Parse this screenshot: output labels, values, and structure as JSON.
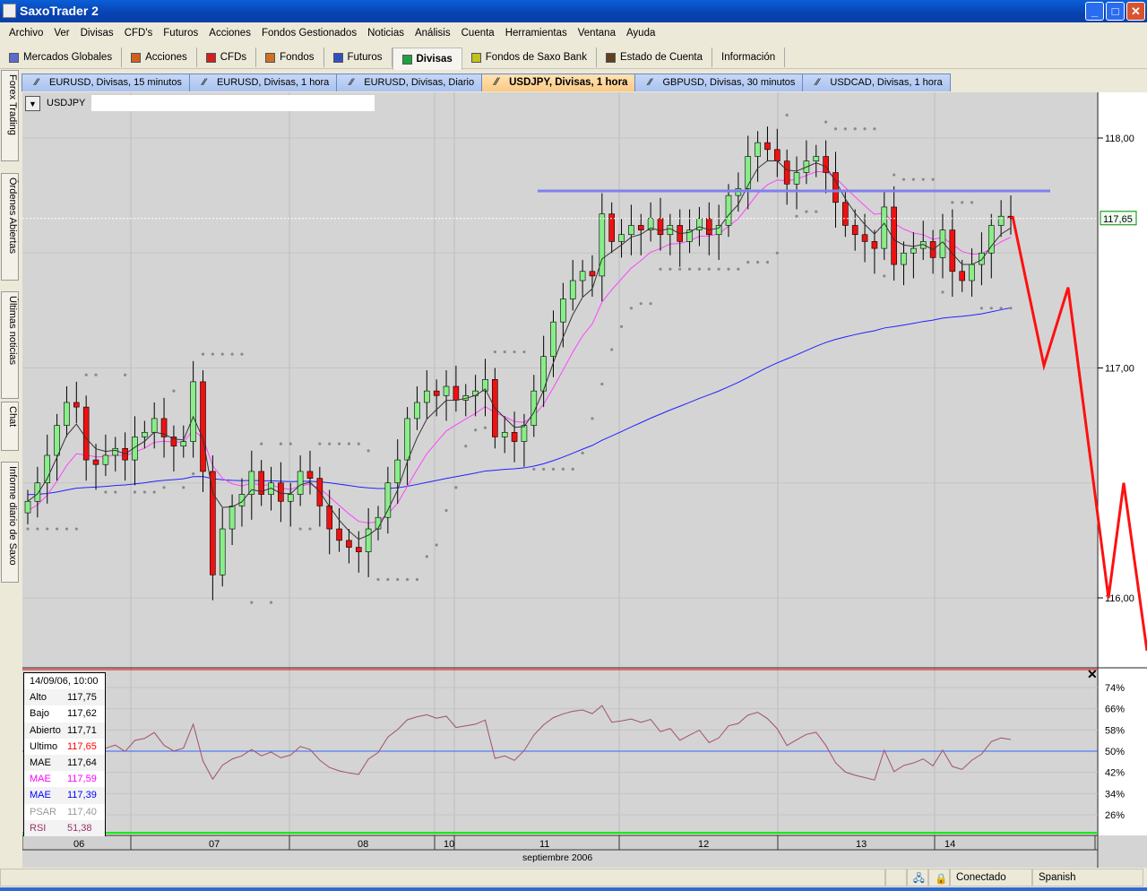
{
  "window": {
    "title": "SaxoTrader 2",
    "minimize": "_",
    "maximize": "□",
    "close": "✕"
  },
  "menu": [
    "Archivo",
    "Ver",
    "Divisas",
    "CFD's",
    "Futuros",
    "Acciones",
    "Fondos Gestionados",
    "Noticias",
    "Análisis",
    "Cuenta",
    "Herramientas",
    "Ventana",
    "Ayuda"
  ],
  "toolbar": [
    {
      "label": "Mercados Globales",
      "icon": "gear-icon",
      "color": "#5b6bd0"
    },
    {
      "label": "Acciones",
      "icon": "acciones-icon",
      "color": "#d06020"
    },
    {
      "label": "CFDs",
      "icon": "cfds-icon",
      "color": "#d02020"
    },
    {
      "label": "Fondos",
      "icon": "fondos-icon",
      "color": "#d07020"
    },
    {
      "label": "Futuros",
      "icon": "futuros-icon",
      "color": "#3050c0"
    },
    {
      "label": "Divisas",
      "icon": "divisas-icon",
      "color": "#20a040",
      "active": true
    },
    {
      "label": "Fondos de Saxo Bank",
      "icon": "saxo-fund-icon",
      "color": "#c0c020"
    },
    {
      "label": "Estado de Cuenta",
      "icon": "account-icon",
      "color": "#604020"
    },
    {
      "label": "Información",
      "icon": "",
      "color": ""
    }
  ],
  "tabs": [
    {
      "label": "EURUSD, Divisas, 15 minutos"
    },
    {
      "label": "EURUSD, Divisas, 1 hora"
    },
    {
      "label": "EURUSD, Divisas, Diario"
    },
    {
      "label": "USDJPY, Divisas, 1 hora",
      "active": true
    },
    {
      "label": "GBPUSD, Divisas, 30 minutos"
    },
    {
      "label": "USDCAD, Divisas, 1 hora"
    }
  ],
  "side_tabs": [
    "Forex Trading",
    "Órdenes Abiertas",
    "Últimas noticias",
    "Chat",
    "Informe diario de Saxo"
  ],
  "symbol": "USDJPY",
  "info_panel": {
    "date": "14/09/06, 10:00",
    "rows": [
      {
        "k": "Alto",
        "v": "117,75",
        "color": "#000000"
      },
      {
        "k": "Bajo",
        "v": "117,62",
        "color": "#000000"
      },
      {
        "k": "Abierto",
        "v": "117,71",
        "color": "#000000"
      },
      {
        "k": "Ultimo",
        "v": "117,65",
        "color": "#ff0000",
        "kcolor": "#000000"
      },
      {
        "k": "MAE",
        "v": "117,64",
        "color": "#000000"
      },
      {
        "k": "MAE",
        "v": "117,59",
        "color": "#ff00ff"
      },
      {
        "k": "MAE",
        "v": "117,39",
        "color": "#0000ff"
      },
      {
        "k": "PSAR",
        "v": "117,40",
        "color": "#999999"
      },
      {
        "k": "RSI",
        "v": "51,38",
        "color": "#993366"
      }
    ]
  },
  "status": {
    "connection": "Conectado",
    "language": "Spanish"
  },
  "chart_data": {
    "type": "candlestick",
    "title": "USDJPY, Divisas, 1 hora",
    "xlabel": "septiembre 2006",
    "x_tick_labels": [
      "06",
      "07",
      "08",
      "10",
      "11",
      "12",
      "13",
      "14"
    ],
    "y_ticks": [
      "118,00",
      "117,00",
      "116,00"
    ],
    "ylim": [
      115.8,
      118.2
    ],
    "last_price": "117,65",
    "last_price_value": 117.65,
    "resistance_line": 117.77,
    "projection": [
      117.66,
      117.01,
      117.35,
      116.0,
      116.5,
      115.77
    ],
    "closes": [
      116.42,
      116.5,
      116.62,
      116.75,
      116.85,
      116.83,
      116.6,
      116.58,
      116.62,
      116.65,
      116.6,
      116.7,
      116.72,
      116.78,
      116.7,
      116.66,
      116.68,
      116.94,
      116.55,
      116.1,
      116.3,
      116.4,
      116.45,
      116.55,
      116.45,
      116.5,
      116.42,
      116.45,
      116.55,
      116.52,
      116.4,
      116.3,
      116.25,
      116.22,
      116.2,
      116.3,
      116.35,
      116.5,
      116.6,
      116.78,
      116.85,
      116.9,
      116.88,
      116.92,
      116.86,
      116.88,
      116.9,
      116.95,
      116.7,
      116.72,
      116.68,
      116.75,
      116.9,
      117.05,
      117.2,
      117.3,
      117.38,
      117.42,
      117.4,
      117.67,
      117.55,
      117.58,
      117.62,
      117.6,
      117.65,
      117.58,
      117.62,
      117.55,
      117.6,
      117.65,
      117.58,
      117.62,
      117.75,
      117.78,
      117.92,
      117.98,
      117.95,
      117.9,
      117.8,
      117.85,
      117.9,
      117.92,
      117.85,
      117.72,
      117.62,
      117.58,
      117.55,
      117.52,
      117.7,
      117.45,
      117.5,
      117.52,
      117.55,
      117.48,
      117.6,
      117.42,
      117.38,
      117.45,
      117.5,
      117.62,
      117.66,
      117.65
    ],
    "rsi": {
      "label": "RSI",
      "y_ticks": [
        "74%",
        "66%",
        "58%",
        "50%",
        "42%",
        "34%",
        "26%"
      ],
      "ylim": [
        18,
        81
      ],
      "overbought": 80,
      "oversold": 20,
      "mid": 50
    }
  }
}
